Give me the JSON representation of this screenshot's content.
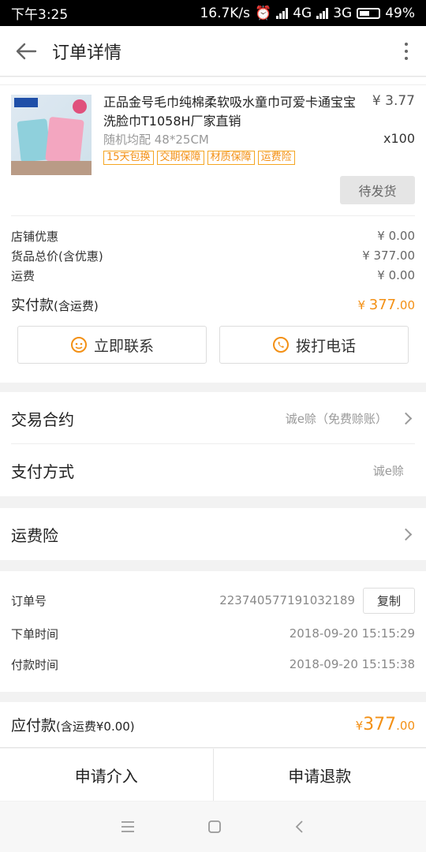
{
  "status_bar": {
    "time": "下午3:25",
    "speed": "16.7K/s",
    "net1": "4G",
    "net2": "3G",
    "battery": "49%"
  },
  "nav": {
    "title": "订单详情"
  },
  "product": {
    "name": "正品金号毛巾纯棉柔软吸水童巾可爱卡通宝宝洗脸巾T1058H厂家直销",
    "price": "¥ 3.77",
    "spec": "随机均配 48*25CM",
    "qty": "x100",
    "badges": [
      "15天包换",
      "交期保障",
      "材质保障",
      "运费险"
    ],
    "status": "待发货"
  },
  "fees": {
    "shop_discount_label": "店铺优惠",
    "shop_discount": "¥ 0.00",
    "goods_total_label": "货品总价(含优惠)",
    "goods_total": "¥ 377.00",
    "shipping_label": "运费",
    "shipping": "¥ 0.00",
    "paid_label": "实付款",
    "paid_note": "(含运费)",
    "paid_symbol": "¥ ",
    "paid_int": "377",
    "paid_dec": ".00"
  },
  "actions": {
    "contact": "立即联系",
    "call": "拨打电话"
  },
  "contract": {
    "label": "交易合约",
    "value": "诚e赊（免费赊账）"
  },
  "payment": {
    "label": "支付方式",
    "value": "诚e赊"
  },
  "insurance": {
    "label": "运费险"
  },
  "order": {
    "no_label": "订单号",
    "no": "223740577191032189",
    "copy": "复制",
    "created_label": "下单时间",
    "created": "2018-09-20 15:15:29",
    "paid_label": "付款时间",
    "paid": "2018-09-20 15:15:38"
  },
  "total": {
    "label": "应付款",
    "note": "(含运费¥0.00)",
    "symbol": "¥",
    "int": "377",
    "dec": ".00"
  },
  "bottom": {
    "intervene": "申请介入",
    "refund": "申请退款"
  },
  "colors": {
    "accent": "#f39015",
    "badge_border": "#f5a623"
  }
}
